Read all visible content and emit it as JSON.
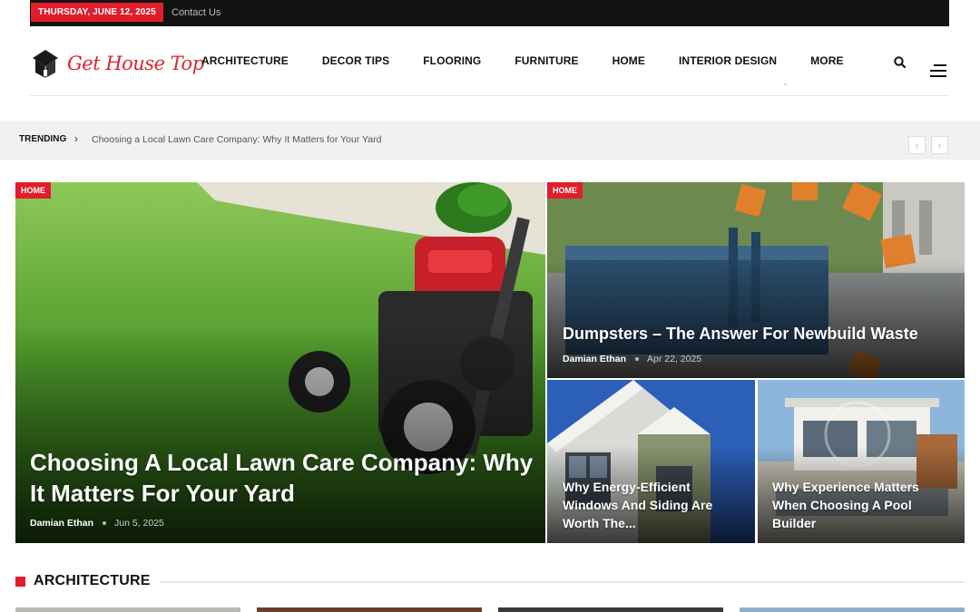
{
  "topbar": {
    "date": "THURSDAY, JUNE 12, 2025",
    "contact": "Contact Us"
  },
  "logo": {
    "text": "Get House Top",
    "icon": "house-logo-icon",
    "color": "#d7262d"
  },
  "nav": {
    "items": [
      {
        "label": "ARCHITECTURE"
      },
      {
        "label": "DECOR TIPS"
      },
      {
        "label": "FLOORING"
      },
      {
        "label": "FURNITURE"
      },
      {
        "label": "HOME"
      },
      {
        "label": "INTERIOR DESIGN"
      },
      {
        "label": "MORE"
      }
    ],
    "search_icon": "search-icon",
    "menu_icon": "hamburger-menu-icon"
  },
  "trending": {
    "label": "TRENDING",
    "headline": "Choosing a Local Lawn Care Company: Why It Matters for Your Yard",
    "prev_icon": "chevron-left-icon",
    "next_icon": "chevron-right-icon"
  },
  "featured": {
    "main": {
      "category": "HOME",
      "title": "Choosing A Local Lawn Care Company: Why It Matters For Your Yard",
      "author": "Damian Ethan",
      "date": "Jun 5, 2025"
    },
    "top_right": {
      "category": "HOME",
      "title": "Dumpsters – The Answer For Newbuild Waste",
      "author": "Damian Ethan",
      "date": "Apr 22, 2025"
    },
    "bottom_left": {
      "title": "Why Energy-Efficient Windows And Siding Are Worth The..."
    },
    "bottom_right": {
      "title": "Why Experience Matters When Choosing A Pool Builder"
    }
  },
  "section": {
    "title": "ARCHITECTURE"
  },
  "colors": {
    "accent": "#e11d2c",
    "topbar": "#121212"
  }
}
